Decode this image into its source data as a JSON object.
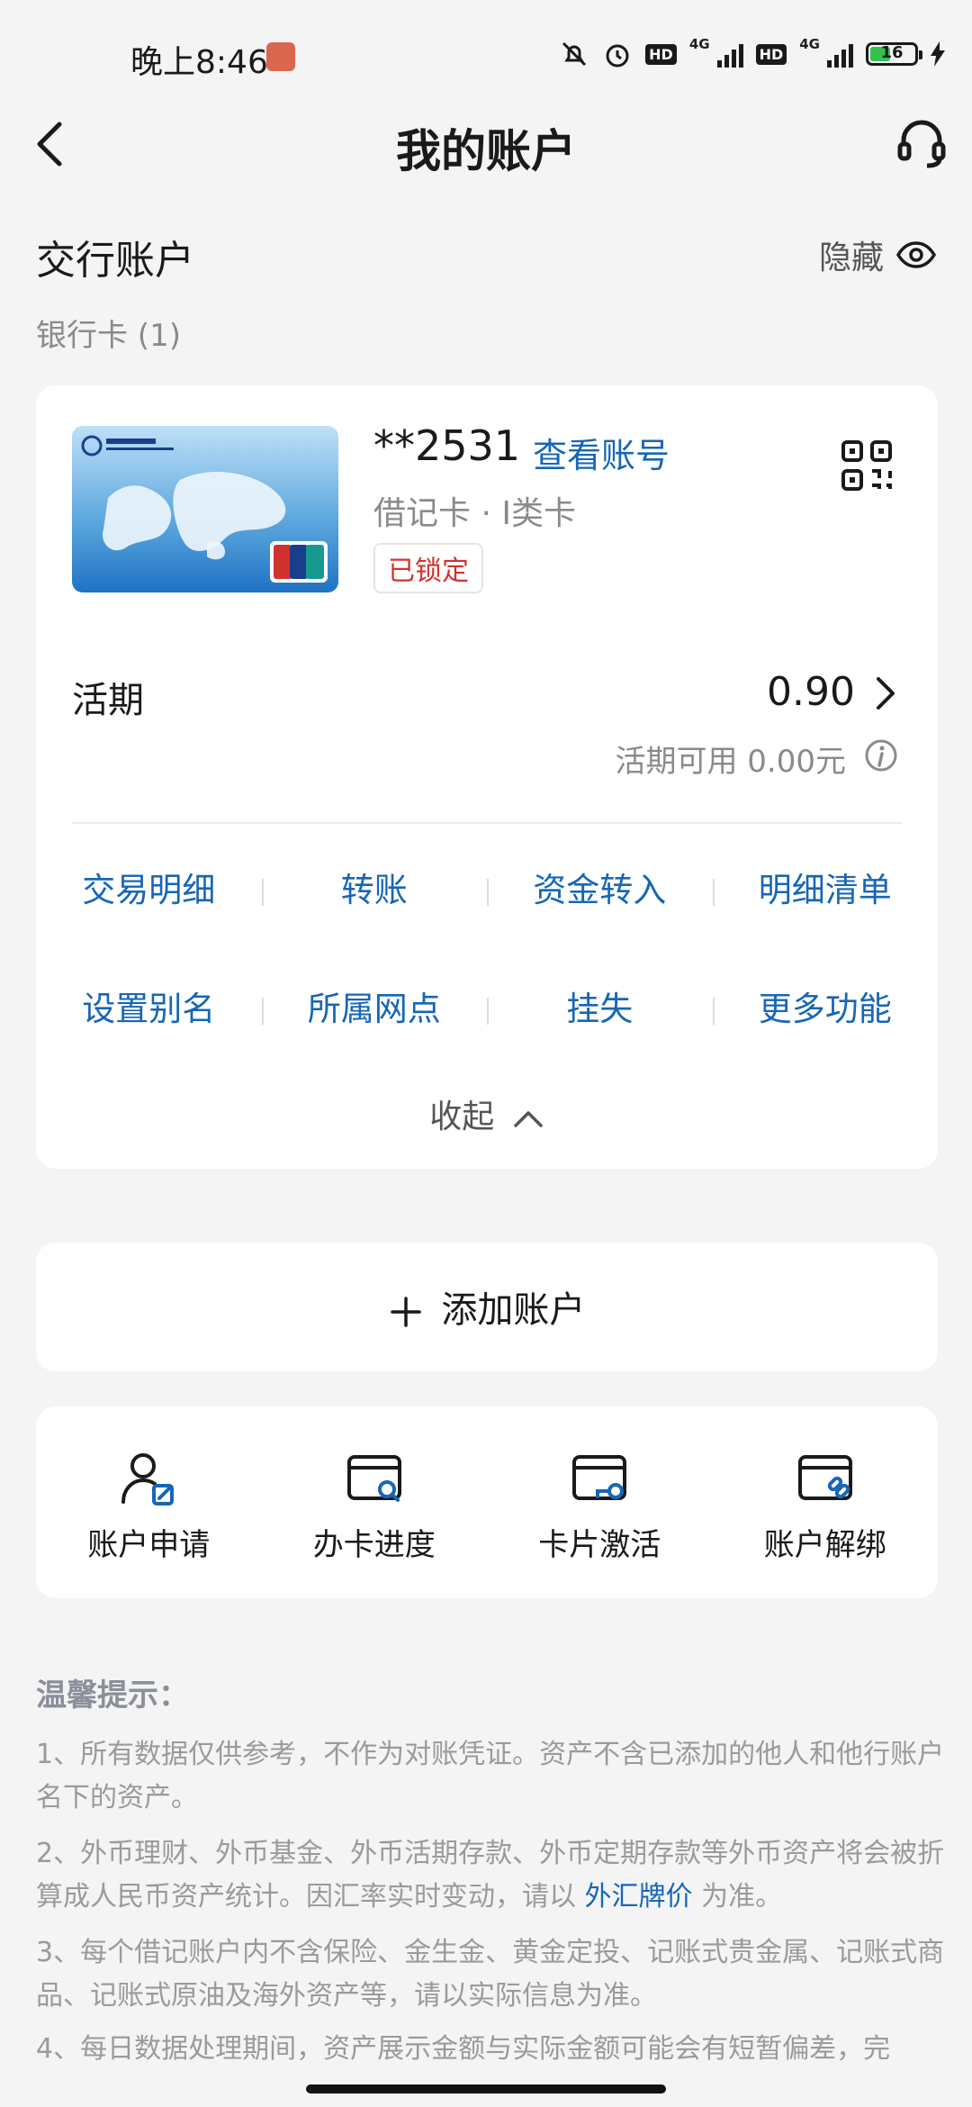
{
  "status_bar": {
    "time": "晚上8:46",
    "network": "4G",
    "hd": "HD",
    "battery": "16"
  },
  "header": {
    "title": "我的账户"
  },
  "section": {
    "title": "交行账户",
    "hide_label": "隐藏",
    "bank_cards_label": "银行卡 (1)"
  },
  "account": {
    "masked_number": "**2531",
    "view_number_link": "查看账号",
    "card_type": "借记卡 · I类卡",
    "status_badge": "已锁定",
    "current_label": "活期",
    "current_balance": "0.90",
    "available_text": "活期可用 0.00元"
  },
  "actions": [
    {
      "label": "交易明细"
    },
    {
      "label": "转账"
    },
    {
      "label": "资金转入"
    },
    {
      "label": "明细清单"
    },
    {
      "label": "设置别名"
    },
    {
      "label": "所属网点"
    },
    {
      "label": "挂失"
    },
    {
      "label": "更多功能"
    }
  ],
  "collapse_label": "收起",
  "add_account_label": "添加账户",
  "quick_actions": [
    {
      "label": "账户申请",
      "icon": "user-edit-icon"
    },
    {
      "label": "办卡进度",
      "icon": "card-search-icon"
    },
    {
      "label": "卡片激活",
      "icon": "card-key-icon"
    },
    {
      "label": "账户解绑",
      "icon": "card-unlink-icon"
    }
  ],
  "tips": {
    "title": "温馨提示：",
    "items": [
      {
        "text": "1、所有数据仅供参考，不作为对账凭证。资产不含已添加的他人和他行账户名下的资产。"
      },
      {
        "text": "2、外币理财、外币基金、外币活期存款、外币定期存款等外币资产将会被折算成人民币资产统计。因汇率实时变动，请以 ",
        "link": "外汇牌价",
        "suffix": " 为准。"
      },
      {
        "text": "3、每个借记账户内不含保险、金生金、黄金定投、记账式贵金属、记账式商品、记账式原油及海外资产等，请以实际信息为准。"
      },
      {
        "text": "4、每日数据处理期间，资产展示金额与实际金额可能会有短暂偏差，完"
      }
    ]
  },
  "colors": {
    "accent": "#1766b6",
    "locked": "#d2322d",
    "background": "#f4f4f5"
  }
}
